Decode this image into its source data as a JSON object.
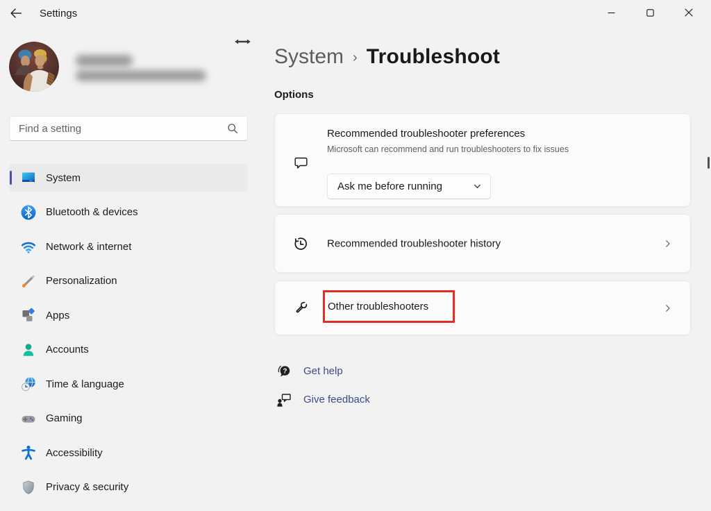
{
  "window": {
    "title": "Settings",
    "controls": [
      {
        "name": "minimize",
        "icon": "minimize-icon"
      },
      {
        "name": "maximize",
        "icon": "maximize-icon"
      },
      {
        "name": "close",
        "icon": "close-icon"
      }
    ]
  },
  "search": {
    "placeholder": "Find a setting",
    "icon": "search-icon"
  },
  "sidebar": {
    "items": [
      {
        "label": "System",
        "icon": "system-icon",
        "selected": true
      },
      {
        "label": "Bluetooth & devices",
        "icon": "bluetooth-icon",
        "selected": false
      },
      {
        "label": "Network & internet",
        "icon": "network-icon",
        "selected": false
      },
      {
        "label": "Personalization",
        "icon": "personalization-icon",
        "selected": false
      },
      {
        "label": "Apps",
        "icon": "apps-icon",
        "selected": false
      },
      {
        "label": "Accounts",
        "icon": "accounts-icon",
        "selected": false
      },
      {
        "label": "Time & language",
        "icon": "time-language-icon",
        "selected": false
      },
      {
        "label": "Gaming",
        "icon": "gaming-icon",
        "selected": false
      },
      {
        "label": "Accessibility",
        "icon": "accessibility-icon",
        "selected": false
      },
      {
        "label": "Privacy & security",
        "icon": "privacy-security-icon",
        "selected": false
      }
    ]
  },
  "main": {
    "breadcrumb": {
      "parent": "System",
      "separator": "›",
      "current": "Troubleshoot"
    },
    "section_label": "Options",
    "preferences_card": {
      "icon": "message-icon",
      "title": "Recommended troubleshooter preferences",
      "description": "Microsoft can recommend and run troubleshooters to fix issues",
      "dropdown_value": "Ask me before running"
    },
    "history_card": {
      "icon": "history-icon",
      "title": "Recommended troubleshooter history"
    },
    "other_card": {
      "icon": "wrench-icon",
      "title": "Other troubleshooters",
      "highlighted": true
    },
    "links": [
      {
        "label": "Get help",
        "icon": "get-help-icon"
      },
      {
        "label": "Give feedback",
        "icon": "give-feedback-icon"
      }
    ]
  },
  "colors": {
    "accent": "#4a52a8",
    "selected_bg": "#eaeaea",
    "link": "#3c4a8d",
    "highlight_red": "#e22d24"
  }
}
